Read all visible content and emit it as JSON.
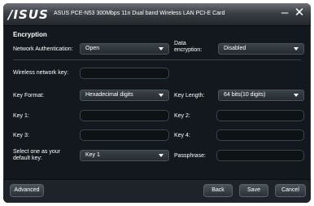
{
  "window": {
    "logo": "/ISUS",
    "title": "ASUS PCE-N53 300Mbps 11n Dual band Wireless LAN PCI-E Card",
    "minimize": "–",
    "close": "✕"
  },
  "section_title": "Encryption",
  "network_auth": {
    "label": "Network Authentication:",
    "value": "Open"
  },
  "data_encryption": {
    "label": "Data encryption:",
    "value": "Disabled"
  },
  "wireless_key": {
    "label": "Wireless network key:",
    "value": ""
  },
  "key_format": {
    "label": "Key Format:",
    "value": "Hexadecimal digits"
  },
  "key_length": {
    "label": "Key Length:",
    "value": "64 bits(10 digits)"
  },
  "key1": {
    "label": "Key 1:",
    "value": ""
  },
  "key2": {
    "label": "Key 2:",
    "value": ""
  },
  "key3": {
    "label": "Key 3:",
    "value": ""
  },
  "key4": {
    "label": "Key 4:",
    "value": ""
  },
  "default_key": {
    "label": "Select one as your default key:",
    "value": "Key 1"
  },
  "passphrase": {
    "label": "Passphrase:",
    "value": ""
  },
  "buttons": {
    "advanced": "Advanced",
    "back": "Back",
    "save": "Save",
    "cancel": "Cancel"
  }
}
